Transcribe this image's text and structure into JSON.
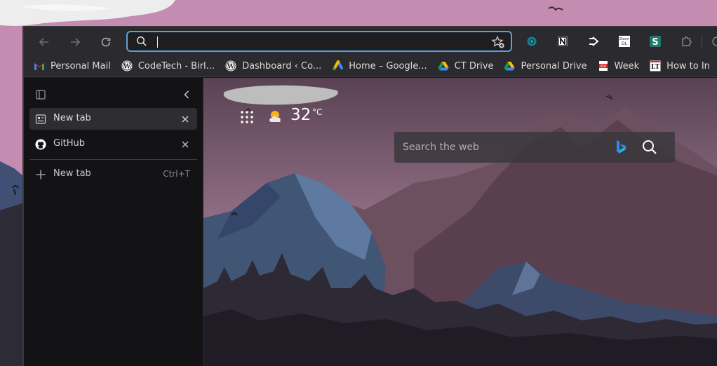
{
  "address_bar": {
    "value": "",
    "placeholder": ""
  },
  "bookmarks": [
    {
      "label": "Personal Mail",
      "icon": "gmail-icon"
    },
    {
      "label": "CodeTech - Birl...",
      "icon": "wordpress-icon"
    },
    {
      "label": "Dashboard ‹ Co...",
      "icon": "wordpress-icon"
    },
    {
      "label": "Home – Google...",
      "icon": "google-ads-icon"
    },
    {
      "label": "CT Drive",
      "icon": "google-drive-icon"
    },
    {
      "label": "Personal Drive",
      "icon": "google-drive-icon"
    },
    {
      "label": "Week",
      "icon": "pdf-icon"
    },
    {
      "label": "How to In",
      "icon": "lt-icon"
    }
  ],
  "sidebar": {
    "tabs": [
      {
        "label": "New tab",
        "icon": "new-tab-page-icon",
        "active": true
      },
      {
        "label": "GitHub",
        "icon": "github-icon",
        "active": false
      }
    ],
    "new_tab": {
      "label": "New tab",
      "shortcut": "Ctrl+T"
    }
  },
  "newtab_page": {
    "weather": {
      "temperature": "32",
      "unit": "°C",
      "icon": "partly-sunny-icon"
    },
    "search": {
      "placeholder": "Search the web"
    }
  },
  "colors": {
    "sky": "#c38cb0",
    "address_border": "#5aa1d6",
    "toolbar": "#2b2b2f",
    "sidebar": "#131215"
  }
}
